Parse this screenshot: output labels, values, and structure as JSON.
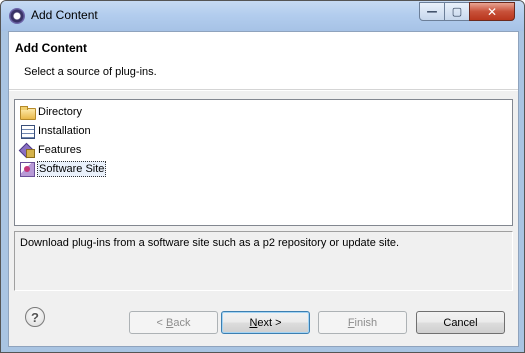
{
  "window": {
    "title": "Add Content",
    "controls": {
      "minimize": "—",
      "maximize": "▢",
      "close": "✕"
    }
  },
  "header": {
    "title": "Add Content",
    "description": "Select a source of plug-ins."
  },
  "sources": [
    {
      "label": "Directory",
      "icon": "folder-icon"
    },
    {
      "label": "Installation",
      "icon": "installation-icon"
    },
    {
      "label": "Features",
      "icon": "features-icon"
    },
    {
      "label": "Software Site",
      "icon": "software-site-icon",
      "selected": true
    }
  ],
  "description_text": "Download plug-ins from a software site such as a p2 repository or update site.",
  "buttons": {
    "help": "?",
    "back": {
      "mnemonic": "B",
      "rest": "ack",
      "prefix": "< "
    },
    "next": {
      "mnemonic": "N",
      "rest": "ext >"
    },
    "finish": {
      "mnemonic": "F",
      "rest": "inish"
    },
    "cancel": "Cancel"
  }
}
